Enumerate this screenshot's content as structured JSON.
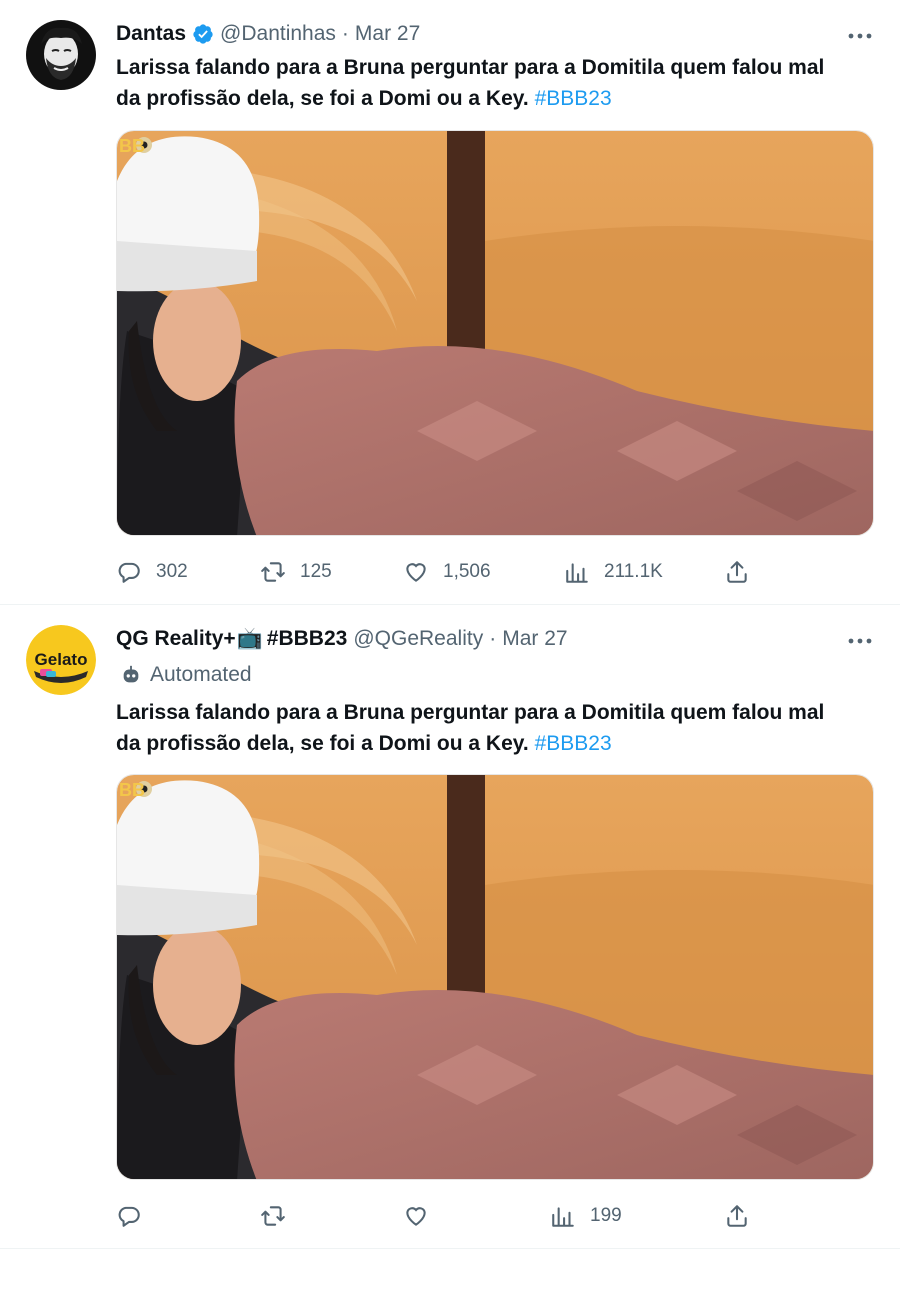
{
  "tweets": [
    {
      "name": "Dantas",
      "verified": true,
      "handle": "@Dantinhas",
      "separator": "·",
      "date": "Mar 27",
      "text": "Larissa falando para a Bruna perguntar para a Domitila quem falou mal da profissão dela, se foi a Domi ou a Key.",
      "hashtag": "#BBB23",
      "avatar_icon": "bearded-man-avatar",
      "actions": {
        "replies": "302",
        "retweets": "125",
        "likes": "1,506",
        "views": "211.1K"
      }
    },
    {
      "name": "QG Reality+",
      "name_emoji": "📺",
      "name_suffix": "#BBB23",
      "handle": "@QGeReality",
      "separator": "·",
      "date": "Mar 27",
      "automated_label": "Automated",
      "text": "Larissa falando para a Bruna perguntar para a Domitila quem falou mal da profissão dela, se foi a Domi ou a Key.",
      "hashtag": "#BBB23",
      "avatar_logo_text": "Gelato",
      "actions": {
        "replies": "",
        "retweets": "",
        "likes": "",
        "views": "199"
      }
    }
  ],
  "media_watermark": "BB",
  "colors": {
    "accent": "#1d9bf0",
    "secondary_text": "#536471",
    "primary_text": "#0f1419"
  }
}
